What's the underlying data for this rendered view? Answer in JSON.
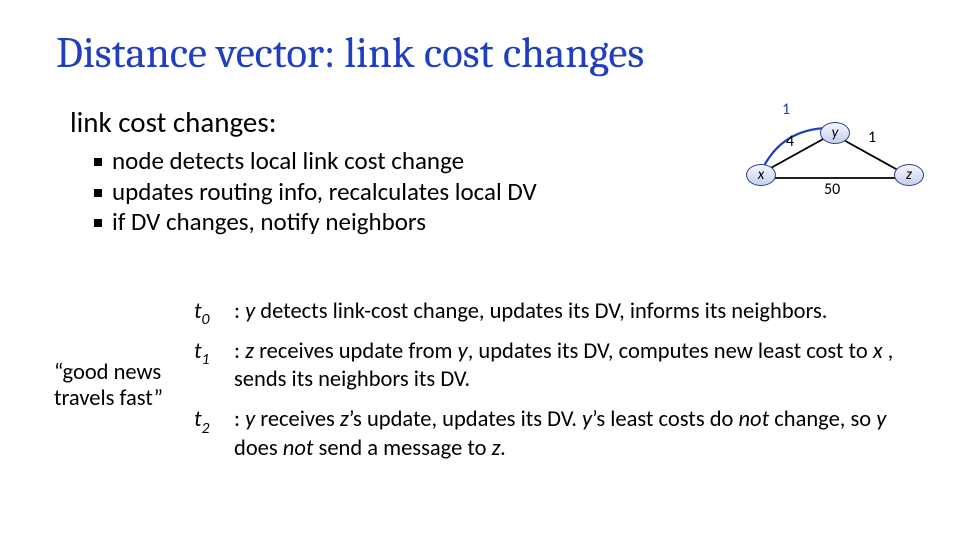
{
  "title": "Distance vector: link cost changes",
  "subheading": "link cost changes:",
  "bullets": [
    "node detects local link cost change",
    "updates routing info, recalculates local DV",
    "if DV changes, notify neighbors"
  ],
  "diagram": {
    "nodes": {
      "x": "x",
      "y": "y",
      "z": "z"
    },
    "edges": {
      "xy_new": "1",
      "xy_old": "4",
      "yz": "1",
      "xz": "50"
    }
  },
  "good_news": "“good news travels fast”",
  "events": [
    {
      "t": "t",
      "sub": "0",
      "text": ": <em>y</em> detects link-cost change, updates its DV, informs its neighbors."
    },
    {
      "t": "t",
      "sub": "1",
      "text": ": <em>z</em> receives update from <em>y</em>, updates its DV, computes new least cost to <em>x</em> , sends its neighbors its DV."
    },
    {
      "t": "t",
      "sub": "2",
      "text": ": <em>y</em> receives <em>z</em>’s update, updates its DV. <em>y</em>’s least costs do <em>not</em> change, so <em>y</em> does <em>not</em> send a message to <em>z.</em>"
    }
  ]
}
